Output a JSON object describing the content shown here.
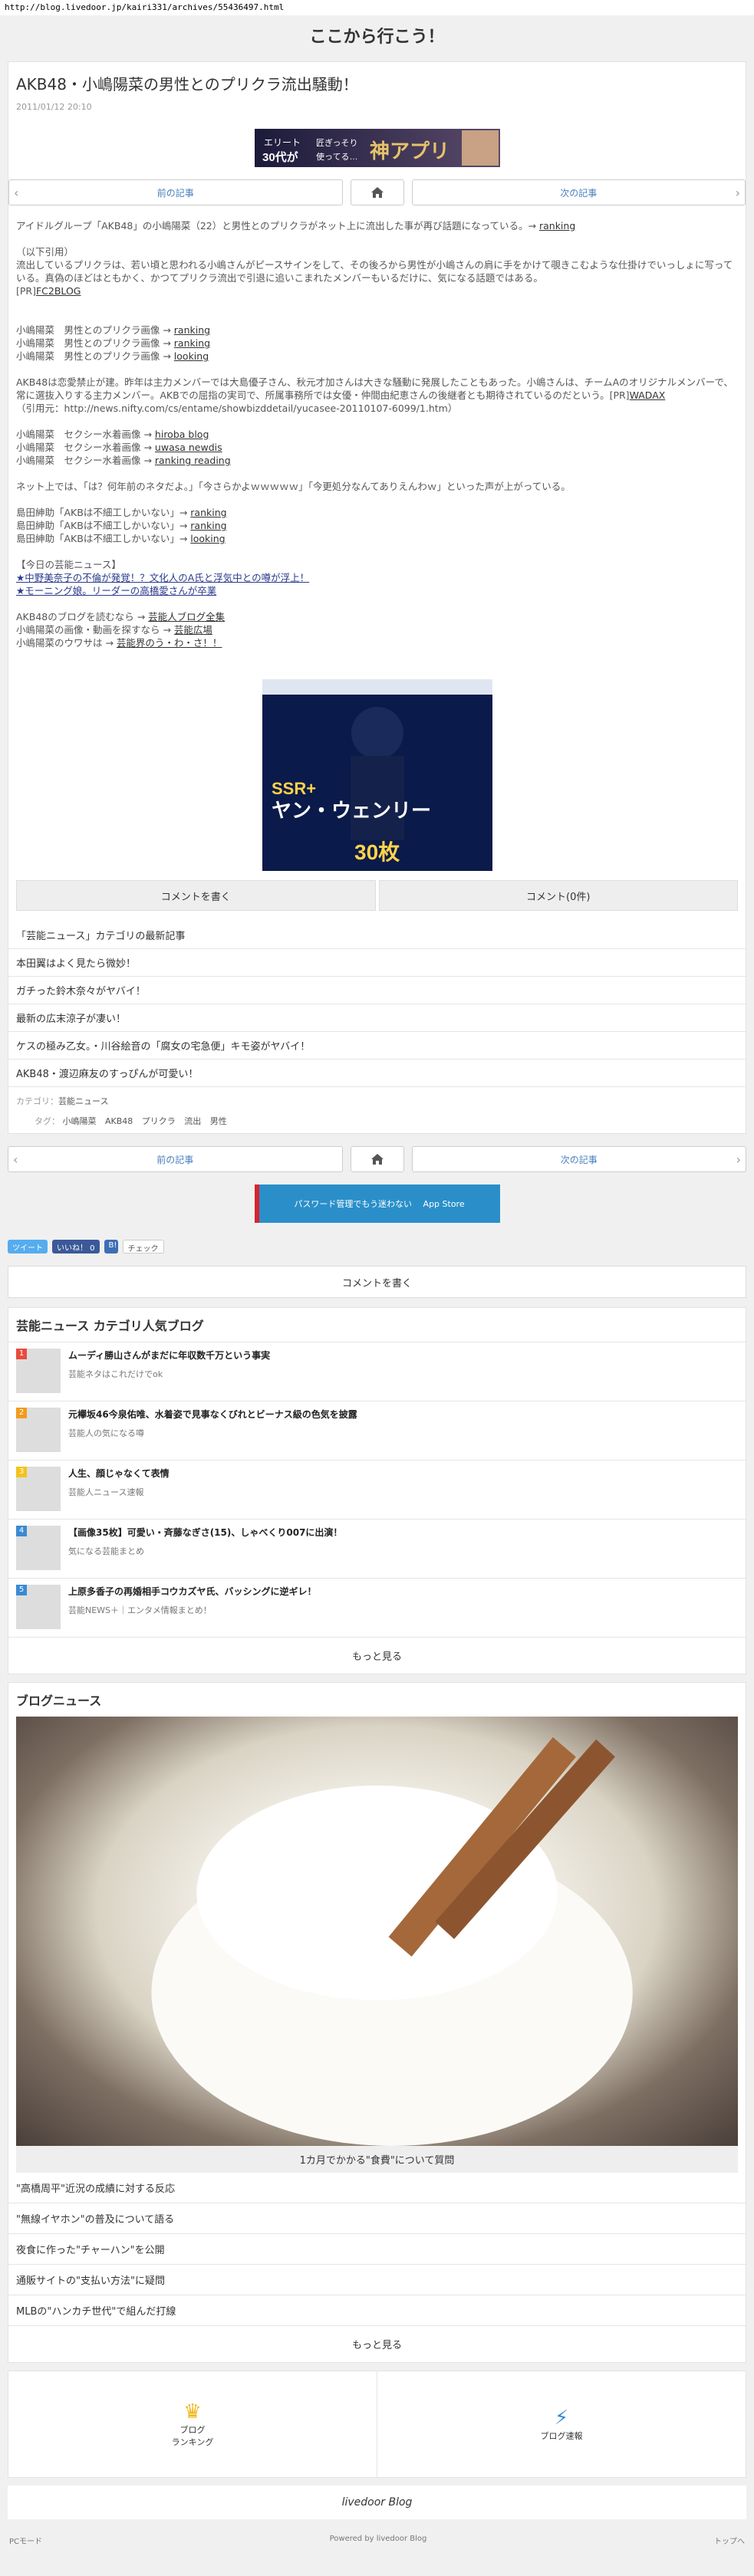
{
  "url": "http://blog.livedoor.jp/kairi331/archives/55436497.html",
  "site_title": "ここから行こう！",
  "article": {
    "title": "AKB48・小嶋陽菜の男性とのプリクラ流出騒動！",
    "date": "2011/01/12 20:10"
  },
  "pager": {
    "prev": "前の記事",
    "next": "次の記事"
  },
  "banners": {
    "top": "エリート30代が 匠ぎっそり使ってる… 神アプリ",
    "ad": "SSR+ ヤン・ウェンリー"
  },
  "body": {
    "p1": "アイドルグループ「AKB48」の小嶋陽菜（22）と男性とのプリクラがネット上に流出した事が再び話題になっている。→ ",
    "p1_link": "ranking",
    "quote_head": "（以下引用）",
    "p2": "流出しているプリクラは、若い頃と思われる小嶋さんがピースサインをして、その後ろから男性が小嶋さんの肩に手をかけて覗きこむような仕掛けでいっしょに写っている。真偽のほどはともかく、かつてプリクラ流出で引退に追いこまれたメンバーもいるだけに、気になる話題ではある。",
    "p2_tail": "[PR]",
    "p2_tail_link": "FC2BLOG",
    "l1": "小嶋陽菜　男性とのプリクラ画像 → ",
    "l1a": "ranking",
    "l2": "小嶋陽菜　男性とのプリクラ画像 → ",
    "l2a": "ranking",
    "l3": "小嶋陽菜　男性とのプリクラ画像 → ",
    "l3a": "looking",
    "p3": "AKB48は恋愛禁止が建。昨年は主力メンバーでは大島優子さん、秋元才加さんは大きな騒動に発展したこともあった。小嶋さんは、チームAのオリジナルメンバーで、常に選抜入りする主力メンバー。AKBでの屈指の実司で、所属事務所では女優・仲間由紀恵さんの後継者とも期待されているのだという。[PR]",
    "p3_link": "WADAX",
    "p3_quote": "（引用元：http://news.nifty.com/cs/entame/showbizddetail/yucasee-20110107-6099/1.htm）",
    "s1": "小嶋陽菜　セクシー水着画像 → ",
    "s1a": "hiroba blog",
    "s2": "小嶋陽菜　セクシー水着画像 → ",
    "s2a": "uwasa newdis",
    "s3": "小嶋陽菜　セクシー水着画像 → ",
    "s3a": "ranking reading",
    "p4": "ネット上では、「は？何年前のネタだよ。」「今さらかよｗｗｗｗｗ」「今更処分なんてありえんわｗ」といった声が上がっている。",
    "t1": "島田紳助「AKBは不細工しかいない」→ ",
    "t1a": "ranking",
    "t2": "島田紳助「AKBは不細工しかいない」→ ",
    "t2a": "ranking",
    "t3": "島田紳助「AKBは不細工しかいない」→ ",
    "t3a": "looking",
    "today_head": "【今日の芸能ニュース】",
    "today1": "★中野美奈子の不倫が発覚！？文化人のA氏と浮気中との噂が浮上！",
    "today2": "★モーニング娘。リーダーの高橋愛さんが卒業",
    "f1": "AKB48のブログを読むなら → ",
    "f1a": "芸能人ブログ全集",
    "f2": "小嶋陽菜の画像・動画を探すなら → ",
    "f2a": "芸能広場",
    "f3": "小嶋陽菜のウワサは → ",
    "f3a": "芸能界のう・わ・さ！！"
  },
  "actions": {
    "write_comment": "コメントを書く",
    "comments": "コメント(0件)"
  },
  "category": {
    "heading": "「芸能ニュース」カテゴリの最新記事",
    "items": [
      "本田翼はよく見たら微妙！",
      "ガチった鈴木奈々がヤバイ！",
      "最新の広末涼子が凄い！",
      "ケスの極み乙女。・川谷絵音の「腐女の宅急便」キモ姿がヤバイ！",
      "AKB48・渡辺麻友のすっぴんが可愛い！"
    ]
  },
  "meta": {
    "cat_label": "カテゴリ：",
    "cat_value": "芸能ニュース",
    "tag_label": "タグ：",
    "tags": [
      "小嶋陽菜",
      "AKB48",
      "プリクラ",
      "流出",
      "男性"
    ]
  },
  "app_banner": "パスワード管理でもう迷わない　 App Store",
  "share": {
    "tweet": "ツイート",
    "like": "いいね！ 0",
    "check": "チェック"
  },
  "popular": {
    "title": "芸能ニュース カテゴリ人気ブログ",
    "items": [
      {
        "num": "1",
        "title": "ムーディ勝山さんがまだに年収数千万という事実",
        "blog": "芸能ネタはこれだけでok",
        "color": "#e94b3c"
      },
      {
        "num": "2",
        "title": "元欅坂46今泉佑唯、水着姿で見事なくびれとビーナス級の色気を披露",
        "blog": "芸能人の気になる噂",
        "color": "#f29b1d"
      },
      {
        "num": "3",
        "title": "人生、顔じゃなくて表情",
        "blog": "芸能人ニュース速報",
        "color": "#f5c318"
      },
      {
        "num": "4",
        "title": "【画像35枚】可愛い・斉藤なぎさ(15)、しゃべくり007に出演！",
        "blog": "気になる芸能まとめ",
        "color": "#3a8ad1"
      },
      {
        "num": "5",
        "title": "上原多香子の再婚相手コウカズヤ氏、バッシングに逆ギレ！",
        "blog": "芸能NEWS＋｜エンタメ情報まとめ！",
        "color": "#3a8ad1"
      }
    ],
    "more": "もっと見る"
  },
  "blog_news": {
    "title": "ブログニュース",
    "caption": "1カ月でかかる\"食費\"について質問",
    "items": [
      "\"高橋周平\"近況の成績に対する反応",
      "\"無線イヤホン\"の普及について語る",
      "夜食に作った\"チャーハン\"を公開",
      "通販サイトの\"支払い方法\"に疑問",
      "MLBの\"ハンカチ世代\"で組んだ打線"
    ],
    "more": "もっと見る"
  },
  "footer_nav": {
    "ranking": "ブログ\nランキング",
    "news": "ブログ速報"
  },
  "logo": "livedoor Blog",
  "footer": {
    "left": "PCモード",
    "center": "Powered by livedoor Blog",
    "right": "トップへ"
  }
}
